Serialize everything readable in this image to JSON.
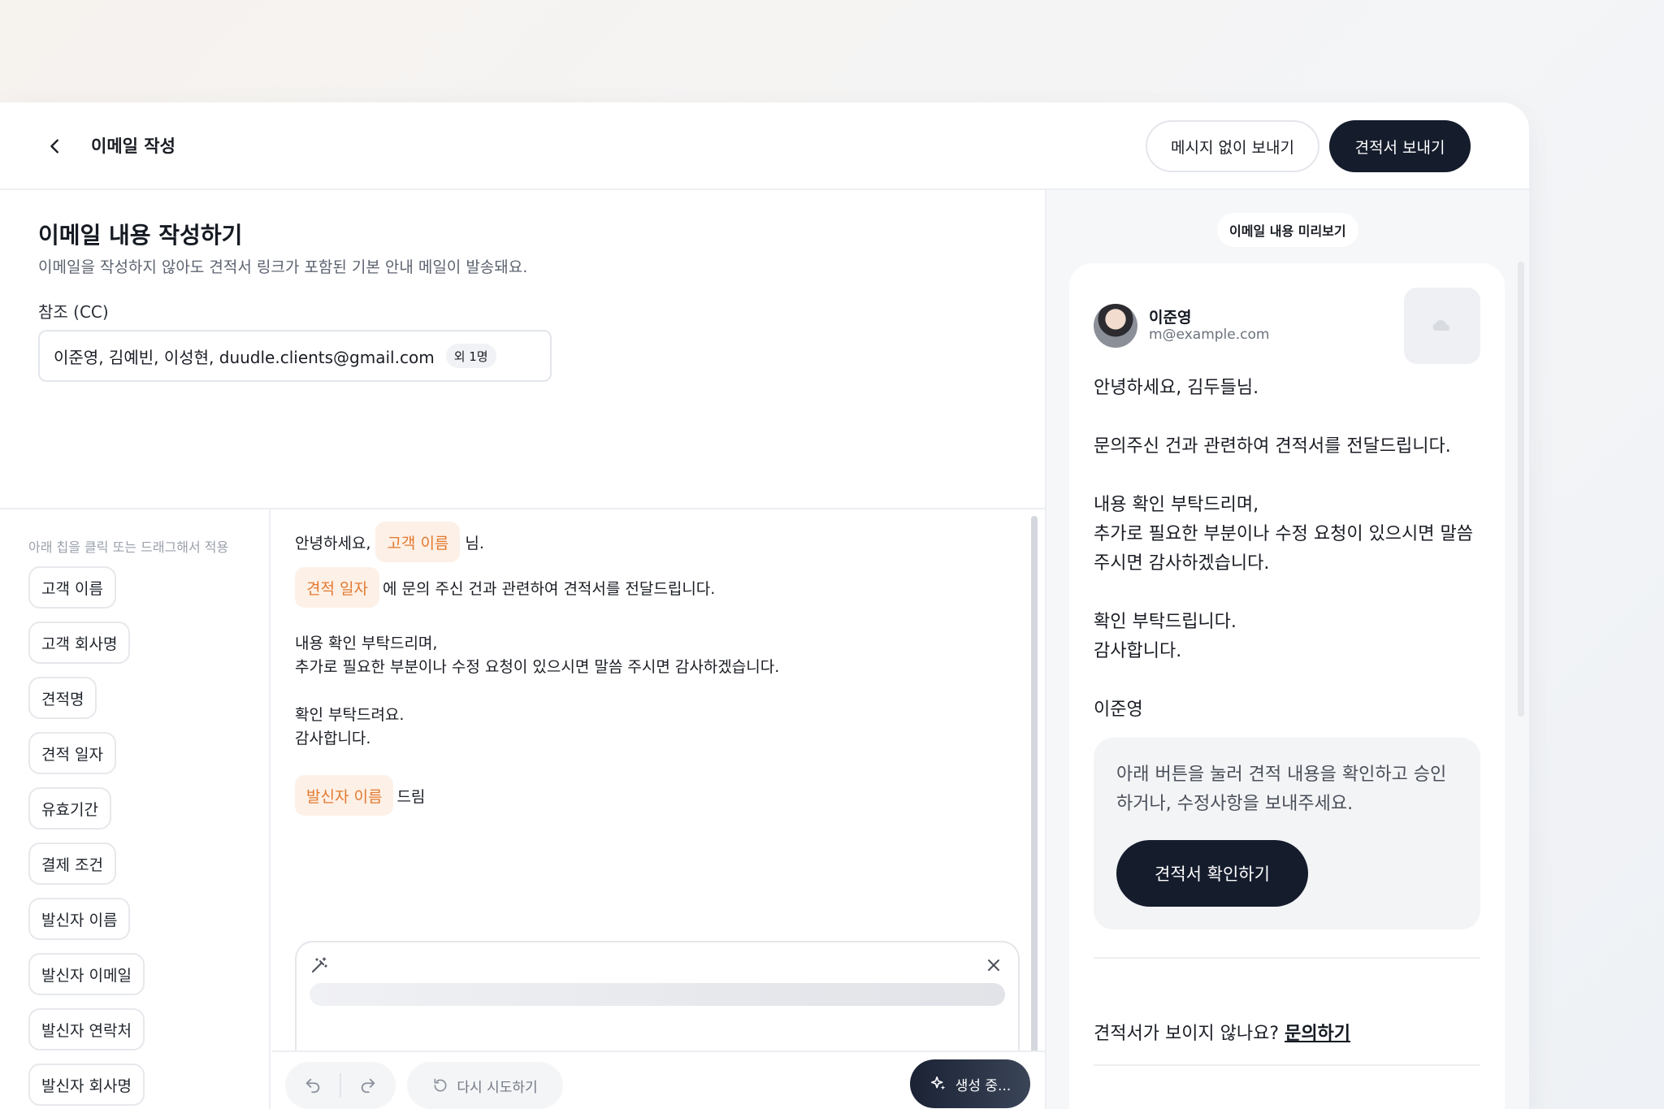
{
  "header": {
    "title": "이메일 작성",
    "send_without_message": "메시지 없이 보내기",
    "send_quote": "견적서 보내기"
  },
  "compose": {
    "title": "이메일 내용 작성하기",
    "description": "이메일을 작성하지 않아도 견적서 링크가 포함된 기본 안내 메일이 발송돼요.",
    "cc_label": "참조 (CC)",
    "cc_value": "이준영, 김예빈, 이성현, duudle.clients@gmail.com",
    "cc_more": "외 1명"
  },
  "chips": {
    "hint": "아래 칩을 클릭 또는 드래그해서 적용",
    "items": [
      "고객 이름",
      "고객 회사명",
      "견적명",
      "견적 일자",
      "유효기간",
      "결제 조건",
      "발신자 이름",
      "발신자 이메일",
      "발신자 연락처",
      "발신자 회사명"
    ]
  },
  "editor": {
    "greeting": "안녕하세요,",
    "token_customer": "고객 이름",
    "honorific": "님.",
    "token_date": "견적 일자",
    "line2_rest": "에 문의 주신 건과 관련하여 견적서를 전달드립니다.",
    "line3": "내용 확인 부탁드리며,",
    "line4": "추가로 필요한 부분이나 수정 요청이 있으시면 말씀 주시면 감사하겠습니다.",
    "line5": "확인 부탁드려요.",
    "line6": "감사합니다.",
    "token_sender": "발신자 이름",
    "sign_suffix": "드림"
  },
  "toolbar": {
    "retry": "다시 시도하기",
    "generating": "생성 중..."
  },
  "preview": {
    "label": "이메일 내용 미리보기",
    "sender_name": "이준영",
    "sender_email": "m@example.com",
    "greeting": "안녕하세요, 김두들님.",
    "p1": "문의주신 건과 관련하여 견적서를 전달드립니다.",
    "p2a": "내용 확인 부탁드리며,",
    "p2b": "추가로 필요한 부분이나 수정 요청이 있으시면 말씀",
    "p2c": "주시면 감사하겠습니다.",
    "p3a": "확인 부탁드립니다.",
    "p3b": "감사합니다.",
    "signature": "이준영",
    "cta_line1": "아래 버튼을 눌러 견적 내용을 확인하고 승인",
    "cta_line2": "하거나, 수정사항을 보내주세요.",
    "cta_button": "견적서 확인하기",
    "help_text": "견적서가 보이지 않나요?",
    "help_link": "문의하기"
  },
  "colors": {
    "accent_dark": "#151c2c",
    "token_bg": "#fdf0e6",
    "token_text": "#e3792f"
  }
}
